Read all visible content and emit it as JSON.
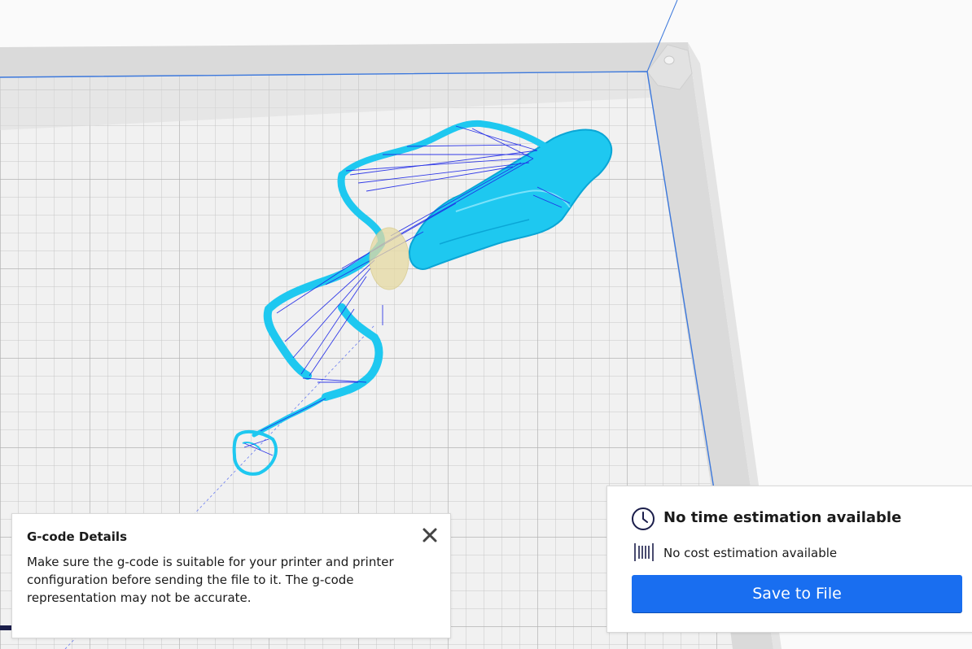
{
  "gcode_details": {
    "title": "G-code Details",
    "message": "Make sure the g-code is suitable for your printer and printer configuration before sending the file to it. The g-code representation may not be accurate.",
    "close_icon": "close-icon"
  },
  "print_info": {
    "time_icon": "clock-icon",
    "time_label": "No time estimation available",
    "cost_icon": "spool-icon",
    "cost_label": "No cost estimation available",
    "save_label": "Save to File"
  },
  "colors": {
    "accent": "#196ef0",
    "layer_cyan": "#1ec8f0",
    "travel_blue": "#1e28e6",
    "build_plate": "#ededed",
    "grid_line": "#c8c8c8"
  }
}
